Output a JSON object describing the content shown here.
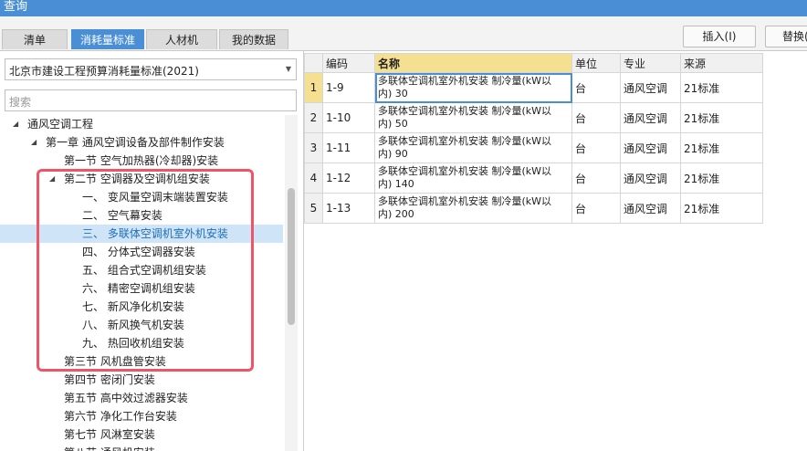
{
  "window": {
    "title": "查询"
  },
  "tabs": [
    {
      "label": "清单",
      "active": false
    },
    {
      "label": "消耗量标准",
      "active": true
    },
    {
      "label": "人材机",
      "active": false
    },
    {
      "label": "我的数据",
      "active": false
    }
  ],
  "buttons": {
    "insert": "插入(I)",
    "replace": "替换("
  },
  "standard_select": {
    "value": "北京市建设工程预算消耗量标准(2021)"
  },
  "search": {
    "placeholder": "搜索"
  },
  "tree": [
    {
      "label": "通风空调工程",
      "arrow": "◢"
    },
    {
      "label": "第一章 通风空调设备及部件制作安装",
      "arrow": "◢"
    },
    {
      "label": "第一节 空气加热器(冷却器)安装",
      "arrow": ""
    },
    {
      "label": "第二节 空调器及空调机组安装",
      "arrow": "◢"
    },
    {
      "label": "一、 变风量空调末端装置安装",
      "arrow": ""
    },
    {
      "label": "二、 空气幕安装",
      "arrow": ""
    },
    {
      "label": "三、 多联体空调机室外机安装",
      "arrow": "",
      "selected": true
    },
    {
      "label": "四、 分体式空调器安装",
      "arrow": ""
    },
    {
      "label": "五、 组合式空调机组安装",
      "arrow": ""
    },
    {
      "label": "六、 精密空调机组安装",
      "arrow": ""
    },
    {
      "label": "七、 新风净化机安装",
      "arrow": ""
    },
    {
      "label": "八、 新风换气机安装",
      "arrow": ""
    },
    {
      "label": "九、 热回收机组安装",
      "arrow": ""
    },
    {
      "label": "第三节 风机盘管安装",
      "arrow": ""
    },
    {
      "label": "第四节 密闭门安装",
      "arrow": ""
    },
    {
      "label": "第五节 高中效过滤器安装",
      "arrow": ""
    },
    {
      "label": "第六节 净化工作台安装",
      "arrow": ""
    },
    {
      "label": "第七节 风淋室安装",
      "arrow": ""
    },
    {
      "label": "第八节 通风机安装",
      "arrow": ""
    }
  ],
  "table": {
    "headers": [
      "编码",
      "名称",
      "单位",
      "专业",
      "来源"
    ],
    "rows": [
      {
        "n": "1",
        "code": "1-9",
        "name1": "多联体空调机室外机安装 制冷量(kW以",
        "name2": "内) 30",
        "unit": "台",
        "major": "通风空调",
        "source": "21标准"
      },
      {
        "n": "2",
        "code": "1-10",
        "name1": "多联体空调机室外机安装 制冷量(kW以",
        "name2": "内) 50",
        "unit": "台",
        "major": "通风空调",
        "source": "21标准"
      },
      {
        "n": "3",
        "code": "1-11",
        "name1": "多联体空调机室外机安装 制冷量(kW以",
        "name2": "内) 90",
        "unit": "台",
        "major": "通风空调",
        "source": "21标准"
      },
      {
        "n": "4",
        "code": "1-12",
        "name1": "多联体空调机室外机安装 制冷量(kW以",
        "name2": "内) 140",
        "unit": "台",
        "major": "通风空调",
        "source": "21标准"
      },
      {
        "n": "5",
        "code": "1-13",
        "name1": "多联体空调机室外机安装 制冷量(kW以",
        "name2": "内) 200",
        "unit": "台",
        "major": "通风空调",
        "source": "21标准"
      }
    ]
  },
  "colors": {
    "accent": "#4a8fd6",
    "highlight_box": "#ee5566",
    "selection": "#cfe4f7",
    "header_active": "#f4e090"
  }
}
